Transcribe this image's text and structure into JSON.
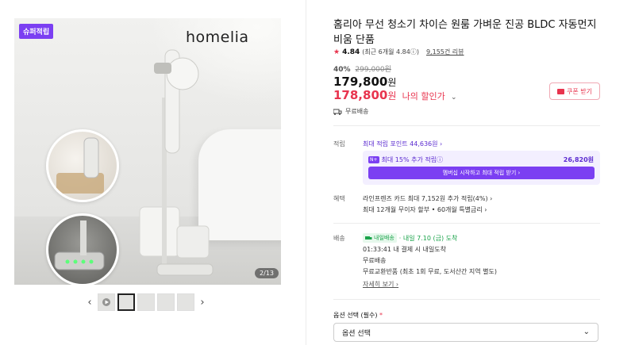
{
  "gallery": {
    "badge": "슈퍼적립",
    "brand": "homelia",
    "page_indicator": "2/13",
    "prev_arrow": "‹",
    "next_arrow": "›"
  },
  "product": {
    "title": "홈리아 무선 청소기 차이슨 원룸 가벼운 진공 BLDC 자동먼지비움 단품",
    "rating": "4.84",
    "rating_recent": "(최근 6개월 4.84ⓘ)",
    "review_count": "9,155건 리뷰",
    "discount_pct": "40%",
    "original_price": "299,000원",
    "price": "179,800",
    "price_won": "원",
    "my_price": "178,800",
    "my_price_won": "원",
    "my_price_label": "나의 할인가",
    "my_price_chevron": "⌄",
    "coupon_label": "쿠폰 받기",
    "shipping_free": "무료배송"
  },
  "points": {
    "label": "적립",
    "max_points": "최대 적립 포인트 44,636원 ›",
    "box_text": "최대 15% 추가 적립ⓘ",
    "box_points": "26,820원",
    "box_pill": "N+",
    "join_button": "멤버십 시작하고 최대 적립 받기 ›"
  },
  "benefit": {
    "label": "혜택",
    "line1": "라인프렌즈 카드 최대 7,152원 추가 적립(4%) ›",
    "line2": "최대 12개월 무이자 할부 • 60개월 특별금리 ›"
  },
  "delivery": {
    "label": "배송",
    "badge": "내일배송",
    "arrival": "· 내일 7.10 (금) 도착",
    "cutoff": "01:33:41  내 결제 시 내일도착",
    "free": "무료배송",
    "return": "무료교환반품 (최초 1회 무료, 도서산간 지역 별도)",
    "more": "자세히 보기 ›"
  },
  "options": {
    "label": "옵션 선택 (필수)",
    "required_mark": "*",
    "placeholder": "옵션 선택",
    "chevron": "⌄"
  },
  "colors": {
    "accent": "#e8344e",
    "purple": "#7b3ff2",
    "green": "#1aa34a"
  }
}
